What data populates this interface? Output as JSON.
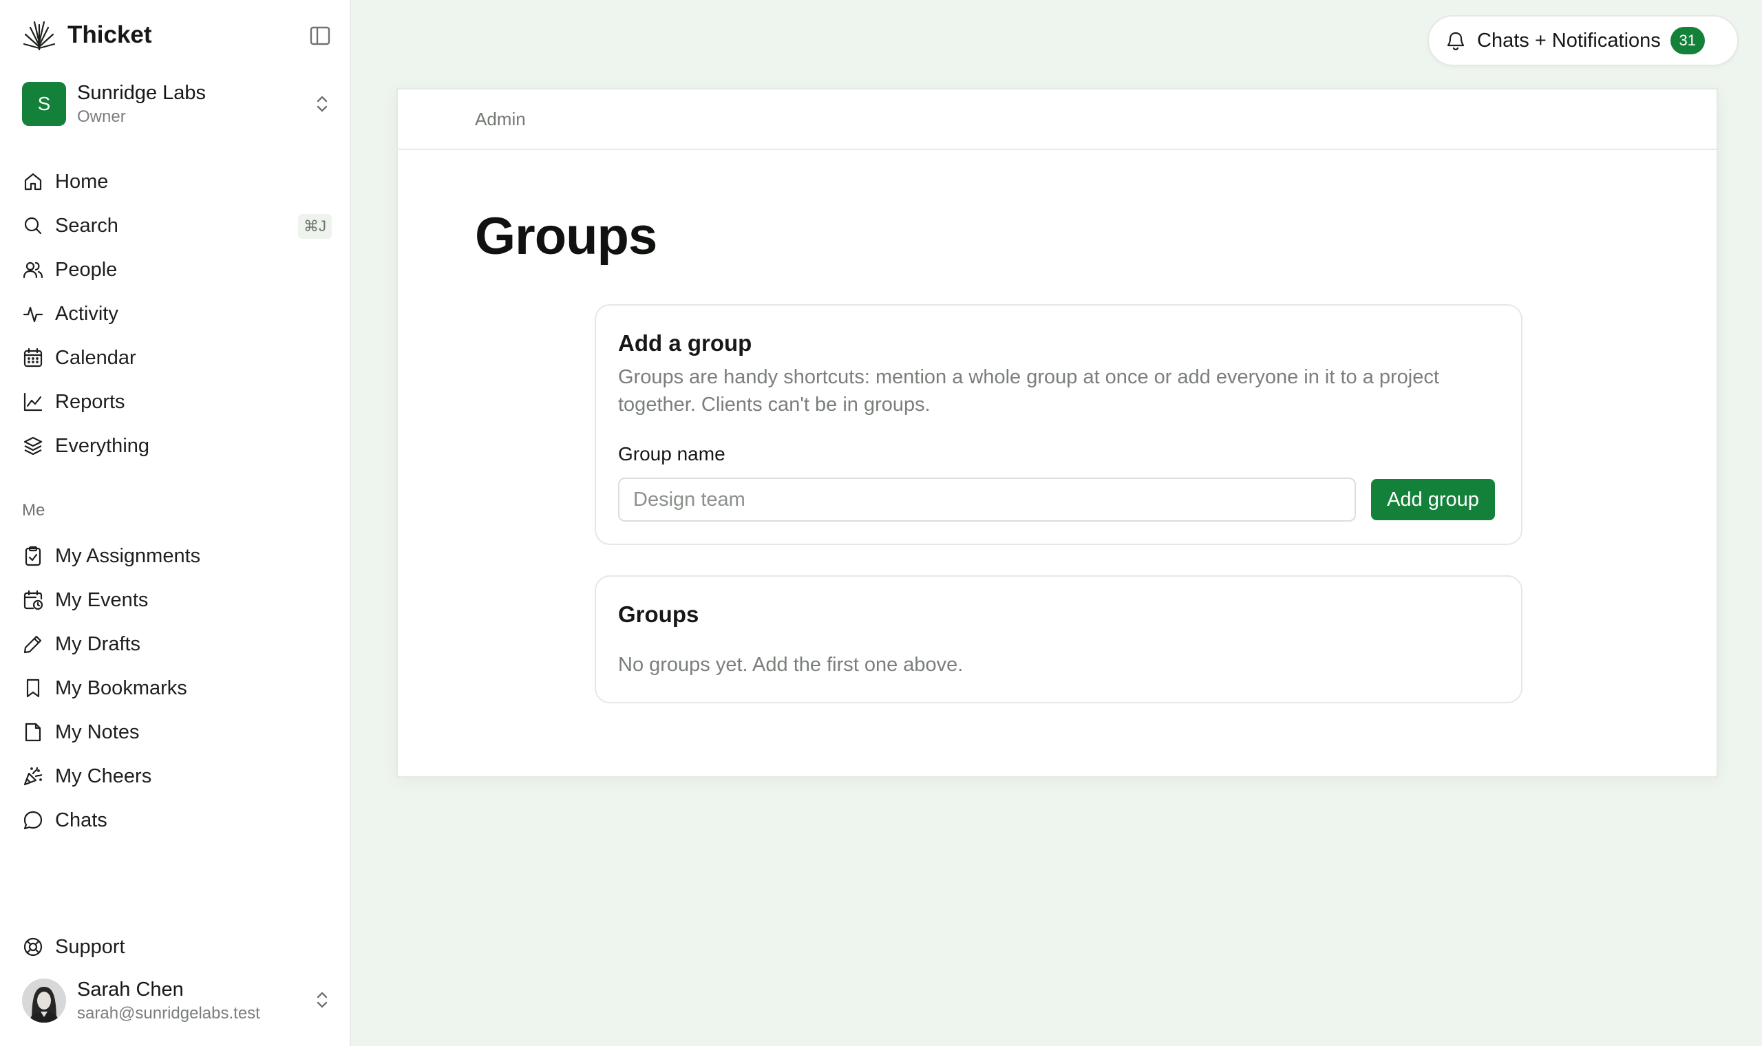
{
  "app": {
    "name": "Thicket"
  },
  "workspace": {
    "initial": "S",
    "name": "Sunridge Labs",
    "role": "Owner"
  },
  "nav": {
    "items": [
      {
        "label": "Home",
        "icon": "home-icon"
      },
      {
        "label": "Search",
        "icon": "search-icon",
        "shortcut": "⌘J"
      },
      {
        "label": "People",
        "icon": "people-icon"
      },
      {
        "label": "Activity",
        "icon": "activity-icon"
      },
      {
        "label": "Calendar",
        "icon": "calendar-icon"
      },
      {
        "label": "Reports",
        "icon": "chart-line-icon"
      },
      {
        "label": "Everything",
        "icon": "layers-icon"
      }
    ],
    "me_label": "Me",
    "me_items": [
      {
        "label": "My Assignments",
        "icon": "clipboard-check-icon"
      },
      {
        "label": "My Events",
        "icon": "calendar-clock-icon"
      },
      {
        "label": "My Drafts",
        "icon": "pencil-icon"
      },
      {
        "label": "My Bookmarks",
        "icon": "bookmark-icon"
      },
      {
        "label": "My Notes",
        "icon": "sticky-note-icon"
      },
      {
        "label": "My Cheers",
        "icon": "party-popper-icon"
      },
      {
        "label": "Chats",
        "icon": "chat-bubble-icon"
      }
    ],
    "support": "Support"
  },
  "user": {
    "name": "Sarah Chen",
    "email": "sarah@sunridgelabs.test"
  },
  "notifications": {
    "label": "Chats + Notifications",
    "count": "31"
  },
  "page": {
    "breadcrumb": "Admin",
    "title": "Groups",
    "add_group": {
      "title": "Add a group",
      "description": "Groups are handy shortcuts: mention a whole group at once or add everyone in it to a project together. Clients can't be in groups.",
      "field_label": "Group name",
      "placeholder": "Design team",
      "value": "",
      "button": "Add group"
    },
    "groups": {
      "title": "Groups",
      "empty": "No groups yet. Add the first one above."
    }
  },
  "colors": {
    "accent": "#14813a",
    "background": "#eef5ee"
  }
}
